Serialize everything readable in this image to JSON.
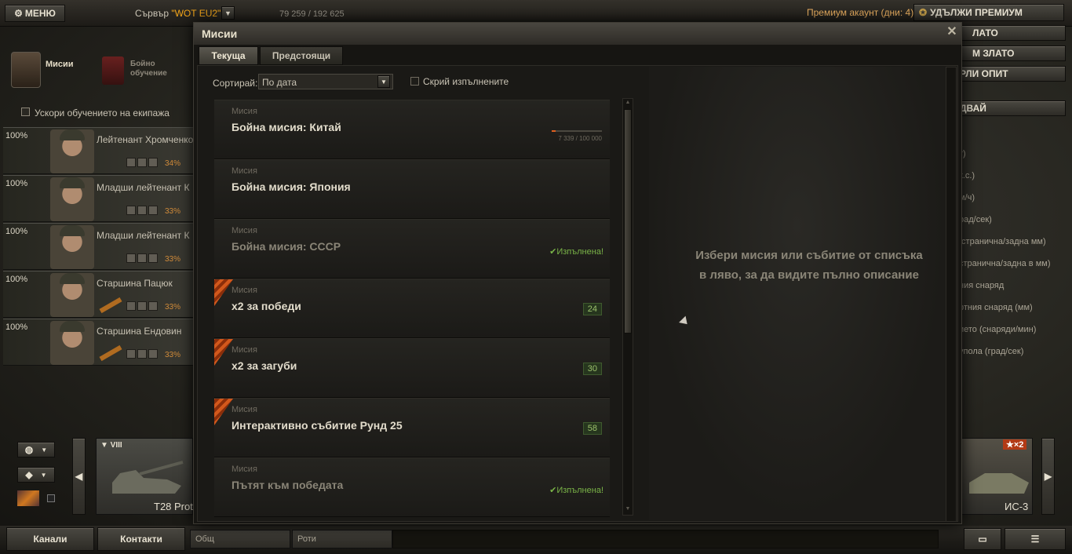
{
  "topbar": {
    "menu_label": "МЕНЮ",
    "server_prefix": "Сървър",
    "server_name": "\"WOT EU2\"",
    "online": "79 259 / 192 625",
    "premium_text": "Премиум акаунт (дни:  4)",
    "premium_button": "УДЪЛЖИ ПРЕМИУМ"
  },
  "right_buttons": [
    "ЛАТО",
    "М ЗЛАТО",
    "РЛИ ОПИТ",
    "ДВАЙ"
  ],
  "side": {
    "missions_label": "Мисии",
    "training_label": "Бойно обучение",
    "accelerate_label": "Ускори обучението на екипажа"
  },
  "crew": [
    {
      "percent": "100%",
      "name": "Лейтенант Хромченко",
      "skill": "34%"
    },
    {
      "percent": "100%",
      "name": "Младши лейтенант К",
      "skill": "33%"
    },
    {
      "percent": "100%",
      "name": "Младши лейтенант К",
      "skill": "33%"
    },
    {
      "percent": "100%",
      "name": "Старшина Пацюк",
      "skill": "33%"
    },
    {
      "percent": "100%",
      "name": "Старшина Ендовин",
      "skill": "33%"
    }
  ],
  "stats": [
    "т)",
    "к.с.)",
    "м/ч)",
    "рад/сек)",
    "/странична/задна мм)",
    "странична/задна в мм)",
    "ния снаряд",
    "ртния снаряд (мм)",
    "ието (снаряди/мин)",
    "упола (град/сек)"
  ],
  "tanks": {
    "left_tier": "▼ VIII",
    "left_name": "T28 Prot",
    "right_x2": "★×2",
    "right_name": "ИС-3"
  },
  "bottom": {
    "channels": "Канали",
    "contacts": "Контакти",
    "chat_general": "Общ",
    "chat_companies": "Роти"
  },
  "window": {
    "title": "Мисии",
    "tab_current": "Текуща",
    "tab_upcoming": "Предстоящи",
    "sort_label": "Сортирай:",
    "sort_value": "По дата",
    "hide_label": "Скрий изпълнените",
    "detail_placeholder": "Избери мисия или събитие от списъка в ляво, за да видите пълно описание",
    "missions": [
      {
        "kind": "Мисия",
        "name": "Бойна мисия: Китай",
        "progress": "7 339 / 100 000",
        "progress_fraction": 0.073
      },
      {
        "kind": "Мисия",
        "name": "Бойна мисия: Япония"
      },
      {
        "kind": "Мисия",
        "name": "Бойна мисия: СССР",
        "status": "✔Изпълнена!"
      },
      {
        "kind": "Мисия",
        "name": "х2 за победи",
        "count": "24"
      },
      {
        "kind": "Мисия",
        "name": "х2 за загуби",
        "count": "30"
      },
      {
        "kind": "Мисия",
        "name": "Интерактивно събитие Рунд 25",
        "count": "58"
      },
      {
        "kind": "Мисия",
        "name": "Пътят към победата",
        "status": "✔Изпълнена!"
      }
    ]
  }
}
